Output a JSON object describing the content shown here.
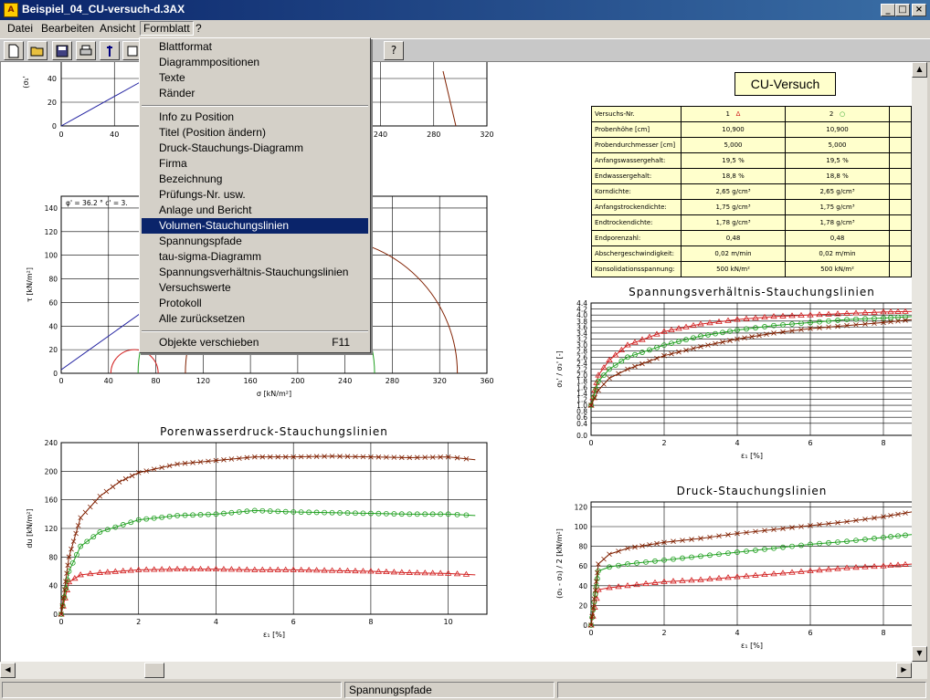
{
  "window": {
    "title": "Beispiel_04_CU-versuch-d.3AX",
    "icon": "document-app-icon",
    "min_glyph": "_",
    "max_glyph": "□",
    "close_glyph": "×"
  },
  "menubar": {
    "items": [
      "Datei",
      "Bearbeiten",
      "Ansicht",
      "Formblatt",
      "?"
    ]
  },
  "toolbar": {
    "buttons": [
      "new-file",
      "open-folder",
      "save",
      "print",
      "tool",
      "image"
    ],
    "help_label": "?"
  },
  "dropdown": {
    "group1": [
      "Blattformat",
      "Diagrammpositionen",
      "Texte",
      "Ränder"
    ],
    "group2": [
      "Info zu Position",
      "Titel (Position ändern)",
      "Druck-Stauchungs-Diagramm",
      "Firma",
      "Bezeichnung",
      "Prüfungs-Nr. usw.",
      "Anlage und Bericht",
      "Volumen-Stauchungslinien",
      "Spannungspfade",
      "tau-sigma-Diagramm",
      "Spannungsverhältnis-Stauchungslinien",
      "Versuchswerte",
      "Protokoll",
      "Alle zurücksetzen"
    ],
    "highlighted": "Volumen-Stauchungslinien",
    "group3_label": "Objekte verschieben",
    "group3_shortcut": "F11"
  },
  "statusbar": {
    "text": "Spannungspfade"
  },
  "cu_title": "CU-Versuch",
  "info_table": {
    "header": [
      "Versuchs-Nr.",
      "1",
      "2"
    ],
    "header_markers": [
      "Δ",
      "○"
    ],
    "rows": [
      [
        "Probenhöhe [cm]",
        "10,900",
        "10,900"
      ],
      [
        "Probendurchmesser [cm]",
        "5,000",
        "5,000"
      ],
      [
        "Anfangswassergehalt:",
        "19,5 %",
        "19,5 %"
      ],
      [
        "Endwassergehalt:",
        "18,8 %",
        "18,8 %"
      ],
      [
        "Korndichte:",
        "2,65 g/cm³",
        "2,65 g/cm³"
      ],
      [
        "Anfangstrockendichte:",
        "1,75 g/cm³",
        "1,75 g/cm³"
      ],
      [
        "Endtrockendichte:",
        "1,78 g/cm³",
        "1,78 g/cm³"
      ],
      [
        "Endporenzahl:",
        "0,48",
        "0,48"
      ],
      [
        "Abschergeschwindigkeit:",
        "0,02 m/min",
        "0,02 m/min"
      ],
      [
        "Konsolidationsspannung:",
        "500 kN/m²",
        "500 kN/m²"
      ]
    ]
  },
  "colors": {
    "series1": "#d22020",
    "series2": "#20a020",
    "series3": "#802000",
    "line_blue": "#2020a0",
    "menu_highlight": "#0a246a"
  },
  "chart_data": [
    {
      "id": "top-left-partial",
      "type": "line",
      "ylabel": "(σ₁'",
      "xticks": [
        "0",
        "40",
        "240",
        "280",
        "320"
      ],
      "yticks": [
        "0",
        "20",
        "40"
      ]
    },
    {
      "id": "tau-sigma",
      "type": "line",
      "xlabel": "σ [kN/m²]",
      "ylabel": "τ [kN/m²]",
      "annotation": "φ' = 36.2 °   c' = 3.",
      "xticks": [
        "0",
        "40",
        "80",
        "120",
        "160",
        "200",
        "240",
        "280",
        "320",
        "360"
      ],
      "yticks": [
        "0",
        "20",
        "40",
        "60",
        "80",
        "100",
        "120",
        "140"
      ],
      "xlim": [
        0,
        360
      ],
      "ylim": [
        0,
        150
      ]
    },
    {
      "id": "porenwasserdruck",
      "type": "line",
      "title": "Porenwasserdruck-Stauchungslinien",
      "xlabel": "ε₁ [%]",
      "ylabel": "du [kN/m²]",
      "xlim": [
        0,
        11
      ],
      "ylim": [
        0,
        240
      ],
      "xticks": [
        "0",
        "2",
        "4",
        "6",
        "8",
        "10"
      ],
      "yticks": [
        "0",
        "40",
        "80",
        "120",
        "160",
        "200",
        "240"
      ],
      "series": [
        {
          "marker": "triangle",
          "x": [
            0,
            0.2,
            0.5,
            1,
            2,
            3,
            4,
            5,
            6,
            7,
            8,
            9,
            10,
            10.7
          ],
          "y": [
            0,
            45,
            55,
            58,
            62,
            63,
            63,
            62,
            62,
            61,
            60,
            58,
            57,
            55
          ]
        },
        {
          "marker": "circle",
          "x": [
            0,
            0.2,
            0.5,
            1,
            2,
            3,
            4,
            5,
            6,
            7,
            8,
            9,
            10,
            10.7
          ],
          "y": [
            0,
            60,
            95,
            115,
            132,
            138,
            140,
            145,
            143,
            142,
            141,
            140,
            140,
            138
          ]
        },
        {
          "marker": "cross",
          "x": [
            0,
            0.2,
            0.5,
            1,
            1.5,
            2,
            3,
            4,
            5,
            6,
            7,
            8,
            9,
            10,
            10.7
          ],
          "y": [
            0,
            80,
            135,
            165,
            185,
            198,
            210,
            215,
            220,
            220,
            221,
            220,
            219,
            220,
            216
          ]
        }
      ]
    },
    {
      "id": "spannungsverhaeltnis",
      "type": "line",
      "title": "Spannungsverhältnis-Stauchungslinien",
      "xlabel": "ε₁ [%]",
      "ylabel": "σ₁' / σ₃' [-]",
      "xlim": [
        0,
        8.8
      ],
      "ylim": [
        0,
        4.4
      ],
      "xticks": [
        "0",
        "2",
        "4",
        "6",
        "8"
      ],
      "yticks": [
        "0.0",
        "0.4",
        "0.6",
        "0.8",
        "1.0",
        "1.2",
        "1.4",
        "1.6",
        "1.8",
        "2.0",
        "2.2",
        "2.4",
        "2.6",
        "2.8",
        "3.0",
        "3.2",
        "3.4",
        "3.6",
        "3.8",
        "4.0",
        "4.2",
        "4.4"
      ],
      "series": [
        {
          "marker": "triangle",
          "x": [
            0,
            0.2,
            0.5,
            1,
            2,
            3,
            4,
            5,
            6,
            7,
            8,
            8.8
          ],
          "y": [
            1.0,
            2.0,
            2.5,
            3.0,
            3.45,
            3.7,
            3.85,
            3.95,
            4.0,
            4.05,
            4.1,
            4.12
          ]
        },
        {
          "marker": "circle",
          "x": [
            0,
            0.2,
            0.5,
            1,
            2,
            3,
            4,
            5,
            6,
            7,
            8,
            8.8
          ],
          "y": [
            1.0,
            1.8,
            2.2,
            2.6,
            3.0,
            3.3,
            3.5,
            3.65,
            3.75,
            3.85,
            3.9,
            3.95
          ]
        },
        {
          "marker": "cross",
          "x": [
            0,
            0.2,
            0.5,
            1,
            2,
            3,
            4,
            5,
            6,
            7,
            8,
            8.8
          ],
          "y": [
            1.0,
            1.5,
            1.9,
            2.2,
            2.65,
            2.95,
            3.2,
            3.4,
            3.55,
            3.65,
            3.75,
            3.85
          ]
        }
      ]
    },
    {
      "id": "druck-stauchung",
      "type": "line",
      "title": "Druck-Stauchungslinien",
      "xlabel": "ε₁ [%]",
      "ylabel": "(σ₁ - σ₃) / 2 [kN/m²]",
      "xlim": [
        0,
        8.8
      ],
      "ylim": [
        0,
        125
      ],
      "xticks": [
        "0",
        "2",
        "4",
        "6",
        "8"
      ],
      "yticks": [
        "0",
        "20",
        "40",
        "60",
        "80",
        "100",
        "120"
      ],
      "series": [
        {
          "marker": "triangle",
          "x": [
            0,
            0.2,
            0.5,
            1,
            2,
            3,
            4,
            5,
            6,
            7,
            8,
            8.8
          ],
          "y": [
            0,
            36,
            38,
            40,
            44,
            46,
            49,
            52,
            55,
            58,
            60,
            62
          ]
        },
        {
          "marker": "circle",
          "x": [
            0,
            0.2,
            0.5,
            1,
            2,
            3,
            4,
            5,
            6,
            7,
            8,
            8.8
          ],
          "y": [
            0,
            55,
            59,
            62,
            66,
            70,
            74,
            78,
            82,
            85,
            89,
            92
          ]
        },
        {
          "marker": "cross",
          "x": [
            0,
            0.2,
            0.5,
            1,
            2,
            3,
            4,
            5,
            6,
            7,
            8,
            8.8
          ],
          "y": [
            0,
            62,
            72,
            78,
            84,
            88,
            93,
            97,
            101,
            105,
            110,
            115
          ]
        }
      ]
    }
  ]
}
